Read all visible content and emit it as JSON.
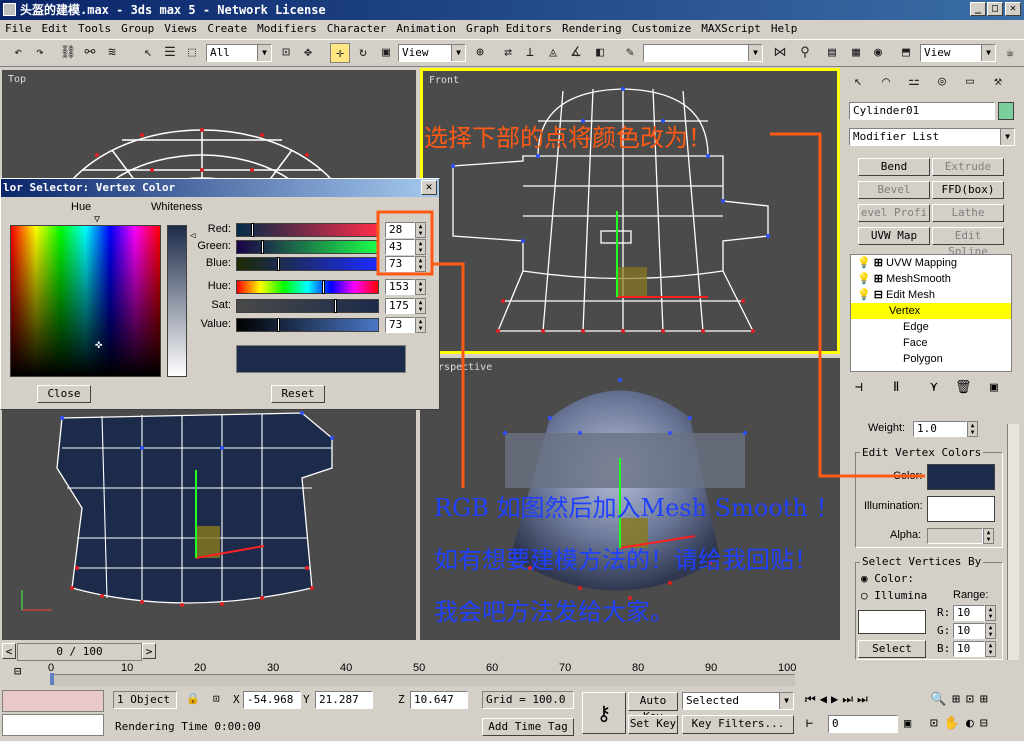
{
  "window": {
    "title": "头盔的建模.max - 3ds max 5 - Network License",
    "min": "_",
    "max": "□",
    "close": "✕"
  },
  "menu": [
    "File",
    "Edit",
    "Tools",
    "Group",
    "Views",
    "Create",
    "Modifiers",
    "Character",
    "Animation",
    "Graph Editors",
    "Rendering",
    "Customize",
    "MAXScript",
    "Help"
  ],
  "toolbar": {
    "selection_filter": "All",
    "ref_coord": "View",
    "named_sel": "",
    "view_right": "View"
  },
  "viewports": {
    "top": "Top",
    "front": "Front",
    "left": "",
    "perspective": "Perspective"
  },
  "color_dialog": {
    "title": "lor Selector: Vertex Color",
    "hue_label": "Hue",
    "whiteness_label": "Whiteness",
    "rows": [
      {
        "label": "Red:",
        "value": "28"
      },
      {
        "label": "Green:",
        "value": "43"
      },
      {
        "label": "Blue:",
        "value": "73"
      },
      {
        "label": "Hue:",
        "value": "153"
      },
      {
        "label": "Sat:",
        "value": "175"
      },
      {
        "label": "Value:",
        "value": "73"
      }
    ],
    "swatch": "#1c2b49",
    "close_label": "Close",
    "reset_label": "Reset"
  },
  "command_panel": {
    "object_name": "Cylinder01",
    "modifier_list": "Modifier List",
    "buttons": [
      {
        "label": "Bend",
        "enabled": true
      },
      {
        "label": "Extrude",
        "enabled": false
      },
      {
        "label": "Bevel",
        "enabled": false
      },
      {
        "label": "FFD(box)",
        "enabled": true
      },
      {
        "label": "evel Profi",
        "enabled": false
      },
      {
        "label": "Lathe",
        "enabled": false
      },
      {
        "label": "UVW Map",
        "enabled": true
      },
      {
        "label": "Edit Spline",
        "enabled": false
      }
    ],
    "stack": [
      "UVW Mapping",
      "MeshSmooth",
      "Edit Mesh",
      "Vertex",
      "Edge",
      "Face",
      "Polygon"
    ],
    "weight_label": "Weight:",
    "weight_value": "1.0",
    "evc_title": "Edit Vertex Colors",
    "color_label": "Color:",
    "illum_label": "Illumination:",
    "alpha_label": "Alpha:",
    "color_value": "#1c2b49",
    "svb_title": "Select Vertices By",
    "radio_color": "Color:",
    "radio_illum": "Illumina",
    "range_label": "Range:",
    "range": [
      {
        "label": "R:",
        "value": "10"
      },
      {
        "label": "G:",
        "value": "10"
      },
      {
        "label": "B:",
        "value": "10"
      }
    ],
    "select_label": "Select"
  },
  "annotations": {
    "line1": "选择下部的点将颜色改为！",
    "line2": "RGB 如图然后加入Mesh Smooth ！",
    "line3": "如有想要建模方法的！请给我回贴！",
    "line4": "我会吧方法发给大家。"
  },
  "timeline": {
    "frame": "0 / 100",
    "ticks": [
      "0",
      "10",
      "20",
      "30",
      "40",
      "50",
      "60",
      "70",
      "80",
      "90",
      "100"
    ]
  },
  "status": {
    "selection": "1 Object",
    "x_label": "X",
    "x": "-54.968",
    "y_label": "Y",
    "y": "21.287",
    "z_label": "Z",
    "z": "10.647",
    "grid": "Grid = 100.0",
    "render_time": "Rendering Time  0:00:00",
    "add_tag": "Add Time Tag",
    "auto_key": "Auto Key",
    "set_key": "Set Key",
    "selected": "Selected",
    "key_filters": "Key Filters...",
    "frame_field": "0"
  }
}
